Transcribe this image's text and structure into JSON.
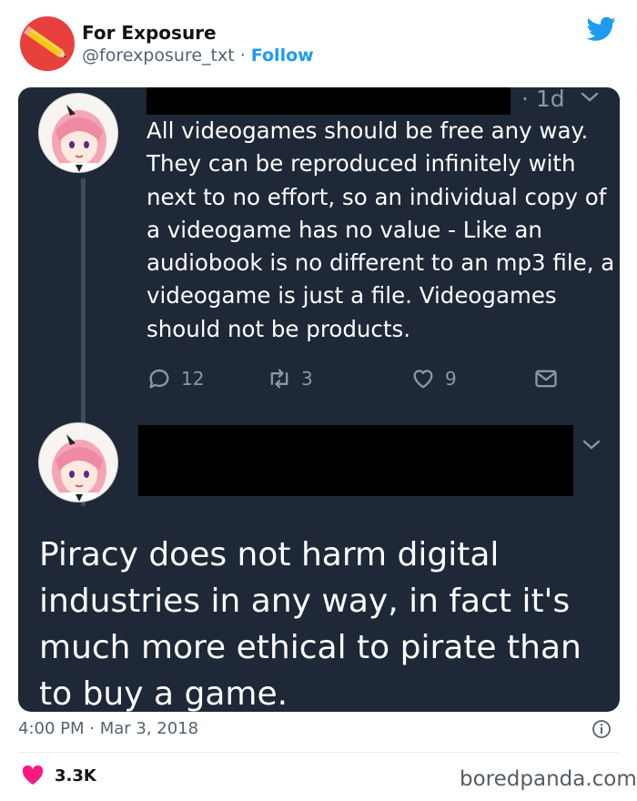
{
  "header": {
    "author_name": "For Exposure",
    "handle": "@forexposure_txt",
    "separator": " · ",
    "follow_label": "Follow",
    "avatar_icon": "pencil-icon",
    "logo_icon": "twitter-bird-icon",
    "brand_color": "#1d9bf0",
    "avatar_color": "#e8403d"
  },
  "embed": {
    "background": "#1e2836",
    "tweet1": {
      "time_ago": "· 1d",
      "text": "All videogames should be free any way. They can be reproduced infinitely with next to no effort, so an individual copy of a videogame has no value - Like an audiobook is no different to an mp3 file, a videogame is just a file. Videogames should not be products.",
      "replies": "12",
      "retweets": "3",
      "likes": "9"
    },
    "tweet2": {
      "text": "Piracy does not harm digital industries in any way, in fact it's much more ethical to pirate than to buy a game."
    }
  },
  "meta": {
    "timestamp": "4:00 PM · Mar 3, 2018",
    "like_count": "3.3K",
    "watermark": "boredpanda.com"
  }
}
